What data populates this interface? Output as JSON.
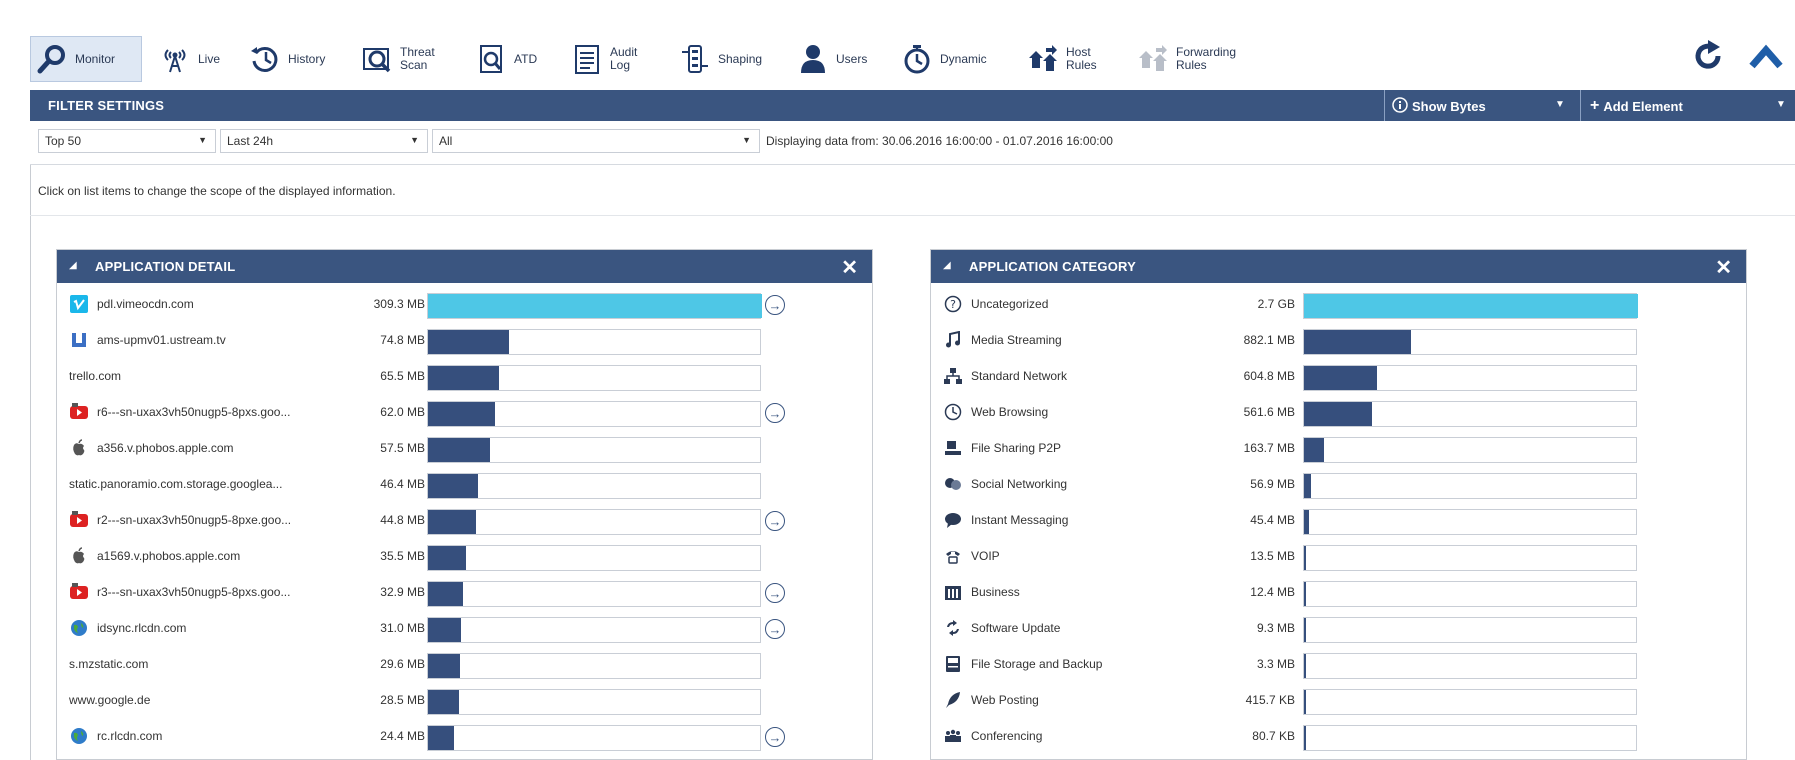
{
  "toolbar": {
    "buttons": [
      {
        "label": "Monitor",
        "icon": "magnifier-icon",
        "active": true
      },
      {
        "label": "Live",
        "icon": "antenna-icon"
      },
      {
        "label": "History",
        "icon": "history-clock-icon"
      },
      {
        "label": "Threat\nScan",
        "icon": "threat-scan-icon"
      },
      {
        "label": "ATD",
        "icon": "atd-icon"
      },
      {
        "label": "Audit\nLog",
        "icon": "audit-log-icon"
      },
      {
        "label": "Shaping",
        "icon": "shaping-icon"
      },
      {
        "label": "Users",
        "icon": "user-icon"
      },
      {
        "label": "Dynamic",
        "icon": "stopwatch-icon"
      },
      {
        "label": "Host\nRules",
        "icon": "host-rules-icon"
      },
      {
        "label": "Forwarding\nRules",
        "icon": "forwarding-rules-icon"
      }
    ],
    "refresh_icon": "refresh-icon",
    "collapse_icon": "chevron-up-icon"
  },
  "filter": {
    "title": "FILTER SETTINGS",
    "show_bytes": "Show Bytes",
    "add_element": "Add Element",
    "select_top": "Top 50",
    "select_range": "Last 24h",
    "select_scope": "All",
    "range_text": "Displaying data from: 30.06.2016 16:00:00 - 01.07.2016 16:00:00"
  },
  "hint": "Click on list items to change the scope of the displayed information.",
  "colors": {
    "header": "#3a5580",
    "bar": "#364f7d",
    "bar_top": "#4ec7e6"
  },
  "app_detail": {
    "title": "APPLICATION DETAIL",
    "rows": [
      {
        "name": "pdl.vimeocdn.com",
        "value": "309.3 MB",
        "ratio": 1.0,
        "icon": "vimeo-icon",
        "drill": true
      },
      {
        "name": "ams-upmv01.ustream.tv",
        "value": "74.8 MB",
        "ratio": 0.242,
        "icon": "ustream-icon",
        "drill": false
      },
      {
        "name": "trello.com",
        "value": "65.5 MB",
        "ratio": 0.212,
        "icon": "",
        "drill": false
      },
      {
        "name": "r6---sn-uxax3vh50nugp5-8pxs.goo...",
        "value": "62.0 MB",
        "ratio": 0.2,
        "icon": "youtube-icon",
        "drill": true
      },
      {
        "name": "a356.v.phobos.apple.com",
        "value": "57.5 MB",
        "ratio": 0.186,
        "icon": "apple-icon",
        "drill": false
      },
      {
        "name": "static.panoramio.com.storage.googlea...",
        "value": "46.4 MB",
        "ratio": 0.15,
        "icon": "",
        "drill": false
      },
      {
        "name": "r2---sn-uxax3vh50nugp5-8pxe.goo...",
        "value": "44.8 MB",
        "ratio": 0.145,
        "icon": "youtube-icon",
        "drill": true
      },
      {
        "name": "a1569.v.phobos.apple.com",
        "value": "35.5 MB",
        "ratio": 0.115,
        "icon": "apple-icon",
        "drill": false
      },
      {
        "name": "r3---sn-uxax3vh50nugp5-8pxs.goo...",
        "value": "32.9 MB",
        "ratio": 0.106,
        "icon": "youtube-icon",
        "drill": true
      },
      {
        "name": "idsync.rlcdn.com",
        "value": "31.0 MB",
        "ratio": 0.1,
        "icon": "globe-icon",
        "drill": true
      },
      {
        "name": "s.mzstatic.com",
        "value": "29.6 MB",
        "ratio": 0.096,
        "icon": "",
        "drill": false
      },
      {
        "name": "www.google.de",
        "value": "28.5 MB",
        "ratio": 0.092,
        "icon": "",
        "drill": false
      },
      {
        "name": "rc.rlcdn.com",
        "value": "24.4 MB",
        "ratio": 0.079,
        "icon": "globe-icon",
        "drill": true
      }
    ]
  },
  "app_category": {
    "title": "APPLICATION CATEGORY",
    "rows": [
      {
        "name": "Uncategorized",
        "value": "2.7 GB",
        "ratio": 1.0,
        "icon": "question-icon"
      },
      {
        "name": "Media Streaming",
        "value": "882.1 MB",
        "ratio": 0.319,
        "icon": "music-note-icon"
      },
      {
        "name": "Standard Network",
        "value": "604.8 MB",
        "ratio": 0.219,
        "icon": "network-icon"
      },
      {
        "name": "Web Browsing",
        "value": "561.6 MB",
        "ratio": 0.203,
        "icon": "web-browsing-icon"
      },
      {
        "name": "File Sharing P2P",
        "value": "163.7 MB",
        "ratio": 0.059,
        "icon": "p2p-icon"
      },
      {
        "name": "Social Networking",
        "value": "56.9 MB",
        "ratio": 0.021,
        "icon": "social-icon"
      },
      {
        "name": "Instant Messaging",
        "value": "45.4 MB",
        "ratio": 0.016,
        "icon": "chat-bubble-icon"
      },
      {
        "name": "VOIP",
        "value": "13.5 MB",
        "ratio": 0.005,
        "icon": "phone-icon"
      },
      {
        "name": "Business",
        "value": "12.4 MB",
        "ratio": 0.0045,
        "icon": "building-icon"
      },
      {
        "name": "Software Update",
        "value": "9.3 MB",
        "ratio": 0.0034,
        "icon": "update-icon"
      },
      {
        "name": "File Storage and Backup",
        "value": "3.3 MB",
        "ratio": 0.0012,
        "icon": "storage-icon"
      },
      {
        "name": "Web Posting",
        "value": "415.7 KB",
        "ratio": 0.0002,
        "icon": "quill-icon"
      },
      {
        "name": "Conferencing",
        "value": "80.7 KB",
        "ratio": 0.0001,
        "icon": "conferencing-icon"
      }
    ]
  }
}
